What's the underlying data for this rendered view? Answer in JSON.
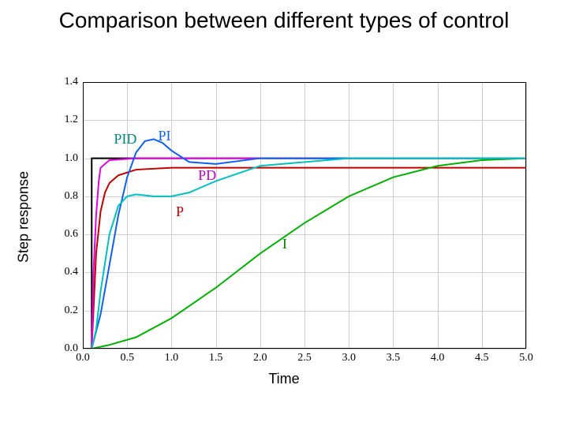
{
  "title": "Comparison between different types of control",
  "ylabel": "Step response",
  "xlabel": "Time",
  "chart_data": {
    "type": "line",
    "xlabel": "Time",
    "ylabel": "Step response",
    "title": "Comparison between different types of control",
    "xlim": [
      0,
      5
    ],
    "ylim": [
      0,
      1.4
    ],
    "xticks": [
      0.0,
      0.5,
      1.0,
      1.5,
      2.0,
      2.5,
      3.0,
      3.5,
      4.0,
      4.5,
      5.0
    ],
    "yticks": [
      0.0,
      0.2,
      0.4,
      0.6,
      0.8,
      1.0,
      1.2,
      1.4
    ],
    "grid": true,
    "legend_position": "inline",
    "series": [
      {
        "name": "setpoint",
        "color": "#000000",
        "x": [
          0.0,
          0.1,
          0.1,
          5.0
        ],
        "values": [
          0.0,
          0.0,
          1.0,
          1.0
        ]
      },
      {
        "name": "P",
        "label_text": "P",
        "color": "#c00000",
        "x": [
          0.0,
          0.1,
          0.15,
          0.2,
          0.25,
          0.3,
          0.4,
          0.6,
          1.0,
          2.0,
          5.0
        ],
        "values": [
          0.0,
          0.0,
          0.5,
          0.72,
          0.82,
          0.87,
          0.91,
          0.94,
          0.95,
          0.95,
          0.95
        ]
      },
      {
        "name": "I",
        "label_text": "I",
        "color": "#00b000",
        "x": [
          0.0,
          0.1,
          0.3,
          0.6,
          1.0,
          1.5,
          2.0,
          2.5,
          3.0,
          3.5,
          4.0,
          4.5,
          5.0
        ],
        "values": [
          0.0,
          0.0,
          0.02,
          0.06,
          0.16,
          0.32,
          0.5,
          0.66,
          0.8,
          0.9,
          0.96,
          0.99,
          1.0
        ]
      },
      {
        "name": "PD",
        "label_text": "PD",
        "color": "#e000e0",
        "x": [
          0.0,
          0.1,
          0.12,
          0.15,
          0.18,
          0.2,
          0.3,
          0.6,
          1.0,
          5.0
        ],
        "values": [
          0.0,
          0.0,
          0.4,
          0.7,
          0.88,
          0.95,
          0.99,
          1.0,
          1.0,
          1.0
        ]
      },
      {
        "name": "PI",
        "label_text": "PI",
        "color": "#1060f0",
        "x": [
          0.0,
          0.1,
          0.2,
          0.3,
          0.4,
          0.5,
          0.6,
          0.7,
          0.8,
          0.9,
          1.0,
          1.2,
          1.5,
          2.0,
          3.0,
          5.0
        ],
        "values": [
          0.0,
          0.0,
          0.18,
          0.44,
          0.7,
          0.9,
          1.03,
          1.09,
          1.1,
          1.08,
          1.04,
          0.98,
          0.97,
          1.0,
          1.0,
          1.0
        ]
      },
      {
        "name": "PID",
        "label_text": "PID",
        "color": "#00c0c0",
        "x": [
          0.0,
          0.1,
          0.15,
          0.2,
          0.3,
          0.4,
          0.5,
          0.6,
          0.8,
          1.0,
          1.2,
          1.5,
          2.0,
          3.0,
          5.0
        ],
        "values": [
          0.0,
          0.0,
          0.1,
          0.3,
          0.6,
          0.75,
          0.8,
          0.81,
          0.8,
          0.8,
          0.82,
          0.88,
          0.96,
          1.0,
          1.0
        ]
      }
    ],
    "series_labels": [
      {
        "text": "PID",
        "x": 0.35,
        "y": 1.1,
        "color": "#008080"
      },
      {
        "text": "PI",
        "x": 0.85,
        "y": 1.12,
        "color": "#1060f0"
      },
      {
        "text": "PD",
        "x": 1.3,
        "y": 0.91,
        "color": "#c000c0"
      },
      {
        "text": "P",
        "x": 1.05,
        "y": 0.72,
        "color": "#c00000"
      },
      {
        "text": "I",
        "x": 2.25,
        "y": 0.55,
        "color": "#008000"
      }
    ],
    "tick_labels": {
      "x": [
        "0.0",
        "0.5",
        "1.0",
        "1.5",
        "2.0",
        "2.5",
        "3.0",
        "3.5",
        "4.0",
        "4.5",
        "5.0"
      ],
      "y": [
        "0.0",
        "0.2",
        "0.4",
        "0.6",
        "0.8",
        "1.0",
        "1.2",
        "1.4"
      ]
    }
  }
}
